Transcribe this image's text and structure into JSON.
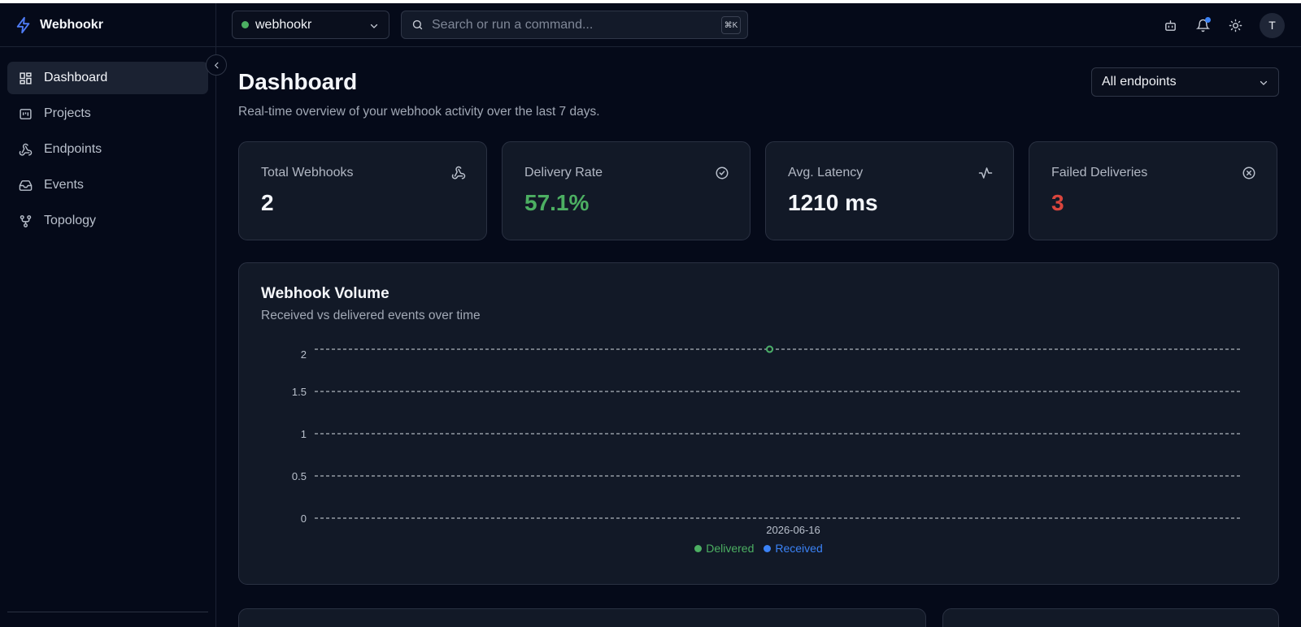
{
  "app": {
    "name": "Webhookr"
  },
  "sidebar": {
    "items": [
      {
        "label": "Dashboard",
        "icon": "dashboard-icon",
        "active": true
      },
      {
        "label": "Projects",
        "icon": "projects-icon"
      },
      {
        "label": "Endpoints",
        "icon": "webhook-icon"
      },
      {
        "label": "Events",
        "icon": "inbox-icon"
      },
      {
        "label": "Topology",
        "icon": "git-fork-icon"
      }
    ]
  },
  "topbar": {
    "project": "webhookr",
    "search_placeholder": "Search or run a command...",
    "shortcut": "⌘K",
    "avatar_initial": "T",
    "icons": [
      "bot-icon",
      "bell-icon",
      "sun-icon"
    ]
  },
  "page": {
    "title": "Dashboard",
    "subtitle": "Real-time overview of your webhook activity over the last 7 days.",
    "endpoint_filter": "All endpoints"
  },
  "stats": [
    {
      "label": "Total Webhooks",
      "value": "2",
      "icon": "webhook-icon",
      "color": "#f4f6fa"
    },
    {
      "label": "Delivery Rate",
      "value": "57.1%",
      "icon": "check-circle-icon",
      "color": "#4caf62"
    },
    {
      "label": "Avg. Latency",
      "value": "1210 ms",
      "icon": "activity-icon",
      "color": "#f4f6fa"
    },
    {
      "label": "Failed Deliveries",
      "value": "3",
      "icon": "x-circle-icon",
      "color": "#d9453d"
    }
  ],
  "chart": {
    "title": "Webhook Volume",
    "subtitle": "Received vs delivered events over time"
  },
  "chart_data": {
    "type": "line",
    "x": [
      "2026-06-16"
    ],
    "series": [
      {
        "name": "Delivered",
        "values": [
          2
        ],
        "color": "#4caf62"
      },
      {
        "name": "Received",
        "values": [
          2
        ],
        "color": "#3b82f6"
      }
    ],
    "yticks": [
      "2",
      "1.5",
      "1",
      "0.5",
      "0"
    ],
    "ylim": [
      0,
      2
    ],
    "grid": true,
    "legend": "bottom-center"
  },
  "colors": {
    "accent": "#3b82f6",
    "success": "#4caf62",
    "danger": "#d9453d"
  }
}
